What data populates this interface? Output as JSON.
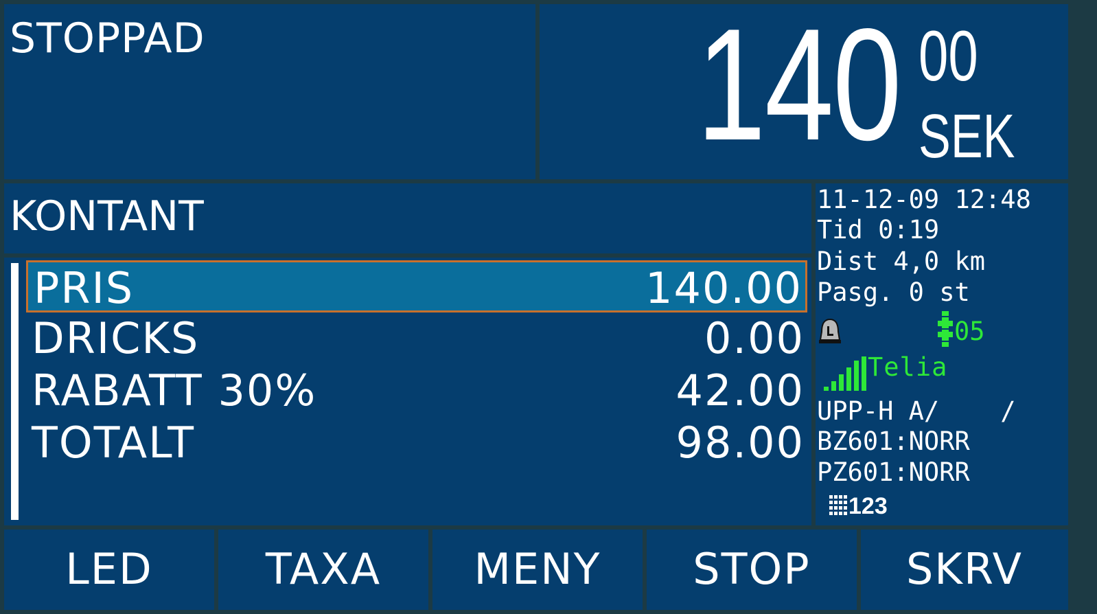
{
  "status": {
    "text": "STOPPAD"
  },
  "fare": {
    "main": "140",
    "cents": "00",
    "currency": "SEK"
  },
  "payment": {
    "mode": "KONTANT"
  },
  "price_list": [
    {
      "label": "PRIS",
      "value": "140.00",
      "selected": true
    },
    {
      "label": "DRICKS",
      "value": "0.00",
      "selected": false
    },
    {
      "label": "RABATT 30%",
      "value": "42.00",
      "selected": false
    },
    {
      "label": "TOTALT",
      "value": "98.00",
      "selected": false
    }
  ],
  "info": {
    "datetime": "11-12-09 12:48",
    "time": "Tid 0:19",
    "distance": "Dist 4,0 km",
    "passengers": "Pasg. 0 st",
    "gps_satellites": "05",
    "operator": "Telia",
    "upp_h": "UPP-H A/    /",
    "bz": "BZ601:NORR",
    "pz": "PZ601:NORR",
    "input_mode": "123"
  },
  "softkeys": [
    "LED",
    "TAXA",
    "MENY",
    "STOP",
    "SKRV"
  ],
  "colors": {
    "panel": "#053e6e",
    "border": "#1c3a44",
    "selected_row": "#0a6e9c",
    "selected_border": "#c8702c",
    "status_green": "#2ee838"
  },
  "icons": [
    "alarm-bell-icon",
    "gps-satellite-icon",
    "signal-strength-icon",
    "keypad-icon"
  ]
}
